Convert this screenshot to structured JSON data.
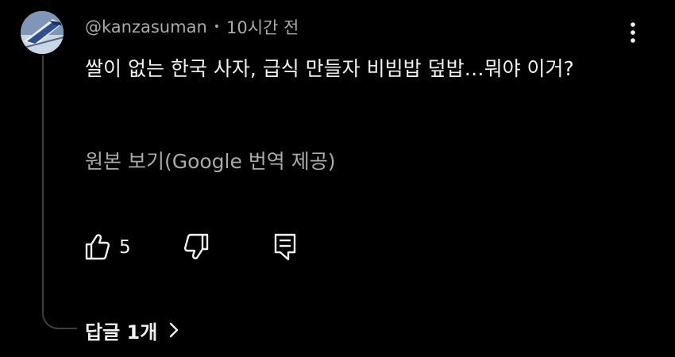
{
  "comment": {
    "author": "@kanzasuman",
    "separator": "•",
    "timestamp": "10시간 전",
    "text": "쌀이 없는 한국 사자, 급식 만들자 비빔밥 덮밥…뭐야 이거?",
    "translate_link": "원본 보기(Google 번역 제공)",
    "like_count": "5",
    "replies_label": "답글 1개"
  },
  "icons": {
    "avatar": "avatar-train-image",
    "more": "more-vertical-icon",
    "like": "thumbs-up-icon",
    "dislike": "thumbs-down-icon",
    "reply": "reply-comment-icon",
    "chevron": "chevron-right-icon"
  },
  "colors": {
    "background": "#000000",
    "primary_text": "#f1f1f1",
    "secondary_text": "#aaaaaa",
    "thread_line": "#3f3f3f"
  }
}
